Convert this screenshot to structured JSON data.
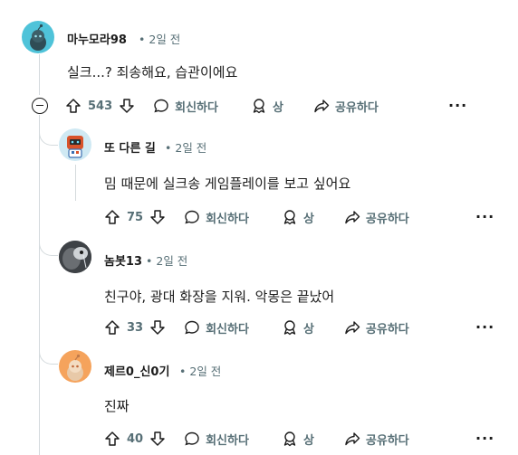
{
  "comments": [
    {
      "username": "마누모라98",
      "time": "2일 전",
      "text": "실크...? 죄송해요, 습관이에요",
      "votes": "543"
    },
    {
      "username": "또 다른 길",
      "time": "2일 전",
      "text": "밈 때문에 실크송 게임플레이를 보고 싶어요",
      "votes": "75"
    },
    {
      "username": "놈봇13",
      "time": "2일 전",
      "text": "친구야, 광대 화장을 지워. 악몽은 끝났어",
      "votes": "33"
    },
    {
      "username": "제르0_신0기",
      "time": "2일 전",
      "text": "진짜",
      "votes": "40"
    }
  ],
  "actions": {
    "reply": "회신하다",
    "award": "상",
    "share": "공유하다",
    "more": "···"
  },
  "separator": "•",
  "colors": {
    "meta": "#576f76",
    "thread_line": "#d4dadd",
    "avatar1_bg": "#4fc3d9",
    "avatar4_bg": "#f5a35c"
  }
}
